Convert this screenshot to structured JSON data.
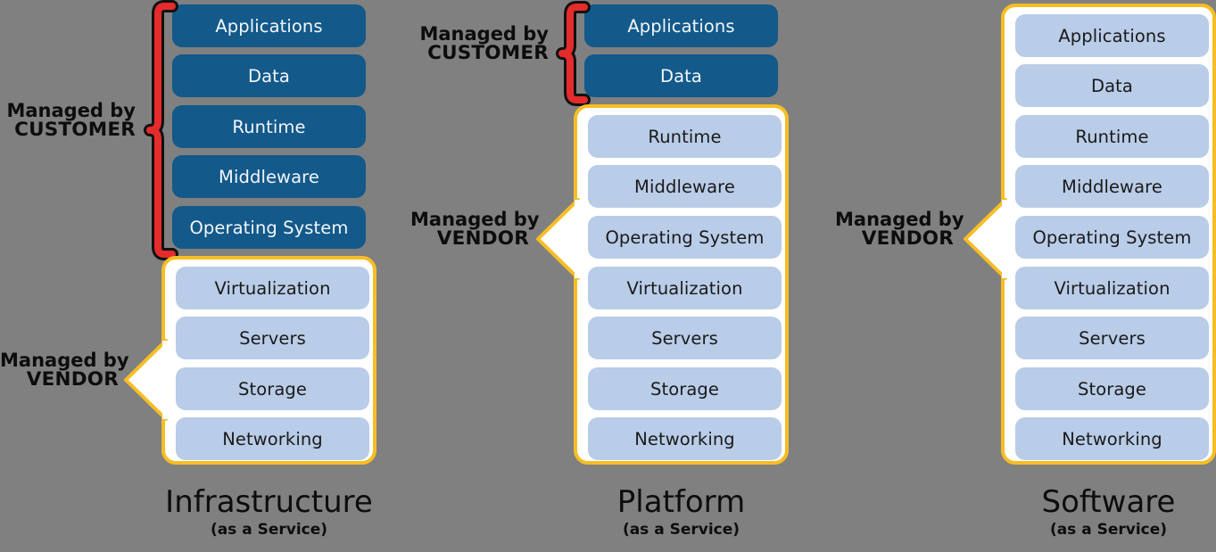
{
  "diagram": {
    "background_color": "#808080",
    "colors": {
      "dark_blue": "#13598A",
      "light_blue": "#B9CCE8",
      "gold": "#F6BE24",
      "white": "#FFFFFF",
      "red": "#E52B2B",
      "black": "#0d0d0d"
    }
  },
  "callout_labels": {
    "customer_line1": "Managed by",
    "customer_line2": "CUSTOMER",
    "vendor_line1": "Managed by",
    "vendor_line2": "VENDOR"
  },
  "columns": [
    {
      "id": "iaas",
      "title_main": "Infrastructure",
      "title_sub": "(as a Service)",
      "customer_layers": [
        "Applications",
        "Data",
        "Runtime",
        "Middleware",
        "Operating  System"
      ],
      "vendor_layers": [
        "Virtualization",
        "Servers",
        "Storage",
        "Networking"
      ],
      "customer_callout_line1": "Managed by",
      "customer_callout_line2": "CUSTOMER",
      "vendor_callout_line1": "Managed by",
      "vendor_callout_line2": "VENDOR"
    },
    {
      "id": "paas",
      "title_main": "Platform",
      "title_sub": "(as a Service)",
      "customer_layers": [
        "Applications",
        "Data"
      ],
      "vendor_layers": [
        "Runtime",
        "Middleware",
        "Operating  System",
        "Virtualization",
        "Servers",
        "Storage",
        "Networking"
      ],
      "customer_callout_line1": "Managed by",
      "customer_callout_line2": "CUSTOMER",
      "vendor_callout_line1": "Managed by",
      "vendor_callout_line2": "VENDOR"
    },
    {
      "id": "saas",
      "title_main": "Software",
      "title_sub": "(as a Service)",
      "customer_layers": [],
      "vendor_layers": [
        "Applications",
        "Data",
        "Runtime",
        "Middleware",
        "Operating  System",
        "Virtualization",
        "Servers",
        "Storage",
        "Networking"
      ],
      "vendor_callout_line1": "Managed by",
      "vendor_callout_line2": "VENDOR"
    }
  ]
}
